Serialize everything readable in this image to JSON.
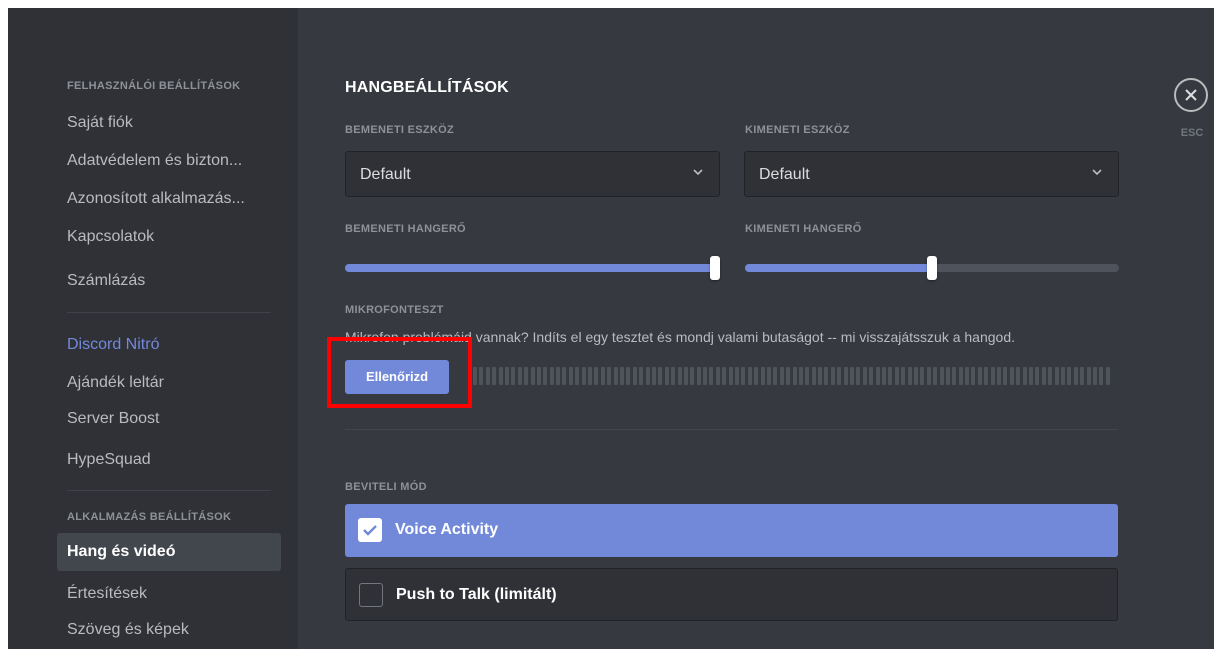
{
  "sidebar": {
    "user_settings_header": "FELHASZNÁLÓI BEÁLLÍTÁSOK",
    "user_items": [
      {
        "label": "Saját fiók"
      },
      {
        "label": "Adatvédelem és bizton..."
      },
      {
        "label": "Azonosított alkalmazás..."
      },
      {
        "label": "Kapcsolatok"
      },
      {
        "label": "Számlázás"
      }
    ],
    "nitro_items": [
      {
        "label": "Discord Nitró"
      },
      {
        "label": "Ajándék leltár"
      },
      {
        "label": "Server Boost"
      },
      {
        "label": "HypeSquad"
      }
    ],
    "app_settings_header": "ALKALMAZÁS BEÁLLÍTÁSOK",
    "app_items": [
      {
        "label": "Hang és videó",
        "active": true
      },
      {
        "label": "Értesítések"
      },
      {
        "label": "Szöveg és képek"
      }
    ]
  },
  "main": {
    "title": "HANGBEÁLLÍTÁSOK",
    "input_device": {
      "label": "BEMENETI ESZKÖZ",
      "value": "Default"
    },
    "output_device": {
      "label": "KIMENETI ESZKÖZ",
      "value": "Default"
    },
    "input_volume": {
      "label": "BEMENETI HANGERŐ",
      "level": 1.0
    },
    "output_volume": {
      "label": "KIMENETI HANGERŐ",
      "level": 0.5
    },
    "mic_test": {
      "label": "MIKROFONTESZT",
      "description": "Mikrofon problémáid vannak? Indíts el egy tesztet és mondj valami butaságot -- mi visszajátsszuk a hangod.",
      "button_label": "Ellenőrizd"
    },
    "input_mode": {
      "label": "BEVITELI MÓD",
      "options": [
        {
          "label": "Voice Activity",
          "selected": true
        },
        {
          "label": "Push to Talk (limitált)",
          "selected": false
        }
      ]
    }
  },
  "close": {
    "esc_label": "ESC"
  },
  "colors": {
    "accent": "#7289da",
    "highlight": "#ff0000",
    "sidebar_bg": "#2f3136",
    "main_bg": "#36393f"
  }
}
